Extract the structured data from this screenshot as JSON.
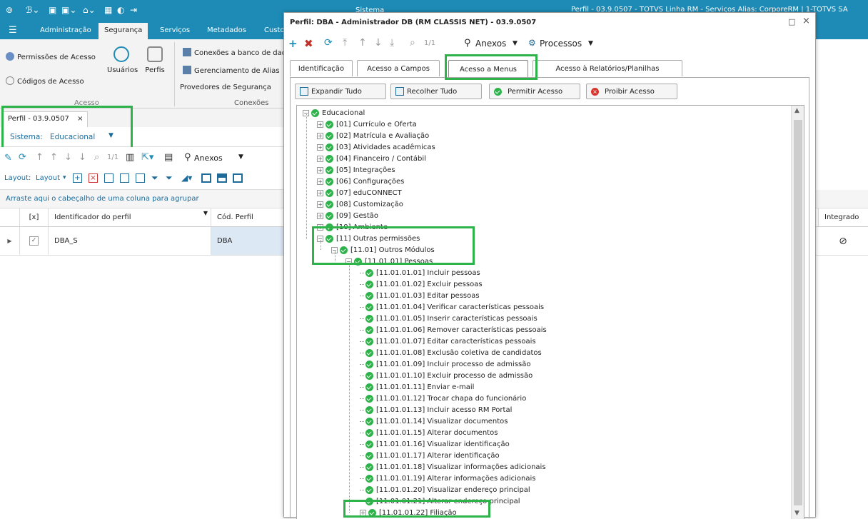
{
  "titlebar": {
    "app_title": "Sistema",
    "window_title": "Perfil - 03.9.0507 - TOTVS Linha RM - Serviços  Alias: CorporeRM | 1-TOTVS SA"
  },
  "menubar": {
    "items": [
      "Administração",
      "Segurança",
      "Serviços",
      "Metadados",
      "Custo"
    ]
  },
  "ribbon": {
    "permissoes": "Permissões de Acesso",
    "codigos": "Códigos de Acesso",
    "usuarios": "Usuários",
    "perfis": "Perfis",
    "acesso_group": "Acesso",
    "conexoes_banco": "Conexões a banco de dad",
    "gerenciamento_alias": "Gerenciamento de Alias",
    "provedores": "Provedores de Segurança",
    "conexoes_group": "Conexões"
  },
  "doc_tab": {
    "label": "Perfil - 03.9.0507",
    "close": "×"
  },
  "system": {
    "label": "Sistema:",
    "value": "Educacional"
  },
  "toolbar1": {
    "pager": "1/1",
    "anexos": "Anexos"
  },
  "toolbar2": {
    "layout_label": "Layout:",
    "layout_btn": "Layout"
  },
  "group_hint": "Arraste aqui o cabeçalho de uma coluna para agrupar",
  "grid": {
    "headers": {
      "check": "[x]",
      "id": "Identificador do perfil",
      "cod": "Cód. Perfil",
      "integrado": "Integrado"
    },
    "row": {
      "id": "DBA_S",
      "cod": "DBA"
    }
  },
  "dialog": {
    "title": "Perfil: DBA - Administrador DB (RM CLASSIS NET) - 03.9.0507",
    "pager": "1/1",
    "anexos": "Anexos",
    "processos": "Processos",
    "tabs": [
      "Identificação",
      "Acesso a Campos",
      "Acesso a Menus",
      "Acesso à Relatórios/Planilhas"
    ],
    "buttons": {
      "expandir": "Expandir Tudo",
      "recolher": "Recolher Tudo",
      "permitir": "Permitir Acesso",
      "proibir": "Proibir Acesso"
    }
  },
  "tree": {
    "root": "Educacional",
    "level1": [
      "[01] Currículo e Oferta",
      "[02] Matrícula e Avaliação",
      "[03] Atividades acadêmicas",
      "[04] Financeiro / Contábil",
      "[05] Integrações",
      "[06] Configurações",
      "[07] eduCONNECT",
      "[08] Customização",
      "[09] Gestão",
      "[10] Ambiente",
      "[11] Outras permissões"
    ],
    "level2": "[11.01] Outros Módulos",
    "level3": "[11.01.01] Pessoas",
    "leaves": [
      "[11.01.01.01] Incluir pessoas",
      "[11.01.01.02] Excluir pessoas",
      "[11.01.01.03] Editar pessoas",
      "[11.01.01.04] Verificar características pessoais",
      "[11.01.01.05] Inserir características pessoais",
      "[11.01.01.06] Remover características pessoais",
      "[11.01.01.07] Editar características pessoais",
      "[11.01.01.08] Exclusão coletiva de candidatos",
      "[11.01.01.09] Incluir processo de admissão",
      "[11.01.01.10] Excluir processo de admissão",
      "[11.01.01.11] Enviar e-mail",
      "[11.01.01.12] Trocar chapa do funcionário",
      "[11.01.01.13] Incluir acesso RM Portal",
      "[11.01.01.14] Visualizar documentos",
      "[11.01.01.15] Alterar documentos",
      "[11.01.01.16] Visualizar identificação",
      "[11.01.01.17] Alterar identificação",
      "[11.01.01.18] Visualizar informações adicionais",
      "[11.01.01.19] Alterar informações adicionais",
      "[11.01.01.20] Visualizar endereço principal",
      "[11.01.01.21] Alterar endereço principal"
    ],
    "last": "[11.01.01.22] Filiação"
  },
  "colors": {
    "accent": "#1e8bb6",
    "highlight": "#2eb34a"
  }
}
